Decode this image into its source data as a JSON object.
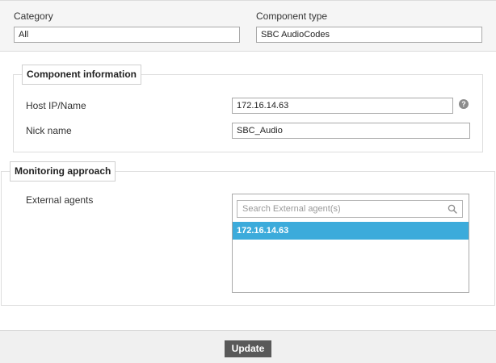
{
  "top": {
    "category_label": "Category",
    "category_value": "All",
    "component_type_label": "Component type",
    "component_type_value": "SBC AudioCodes"
  },
  "component_info": {
    "legend": "Component information",
    "host_label": "Host IP/Name",
    "host_value": "172.16.14.63",
    "help_icon": "help-question-icon",
    "help_glyph": "?",
    "nick_label": "Nick name",
    "nick_value": "SBC_Audio"
  },
  "monitoring": {
    "legend": "Monitoring approach",
    "external_agents_label": "External agents",
    "search_placeholder": "Search External agent(s)",
    "search_icon": "search-icon",
    "agents": [
      {
        "label": "172.16.14.63",
        "selected": true
      }
    ]
  },
  "footer": {
    "update_label": "Update"
  },
  "colors": {
    "selected_item": "#3cabdb",
    "update_button": "#595959"
  }
}
